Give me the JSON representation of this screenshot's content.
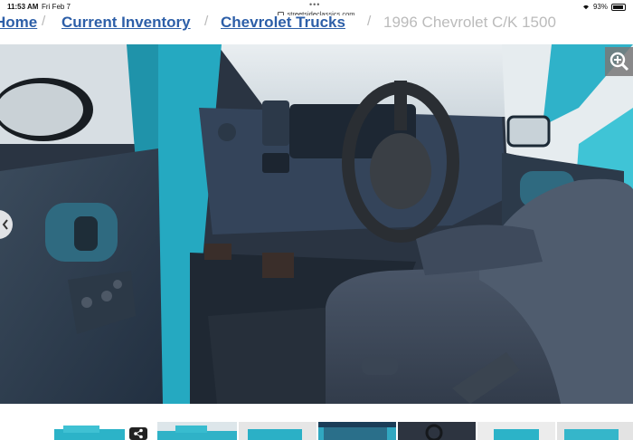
{
  "status_bar": {
    "time": "11:53 AM",
    "date": "Fri Feb 7",
    "battery": "93%"
  },
  "browser": {
    "url": "streetsideclassics.com",
    "menu_dots": "•••"
  },
  "breadcrumbs": [
    "Home",
    "Current Inventory",
    "Chevrolet Trucks"
  ],
  "breadcrumb_current": "1996 Chevrolet C/K 1500",
  "photo": {
    "subject": "truck interior",
    "body_color": "#29b6c9",
    "interior_color": "#3c4a5e"
  },
  "icons": {
    "zoom": "zoom-in-icon",
    "prev": "chevron-left-icon",
    "share": "share-icon"
  },
  "thumbnails_count": 7
}
